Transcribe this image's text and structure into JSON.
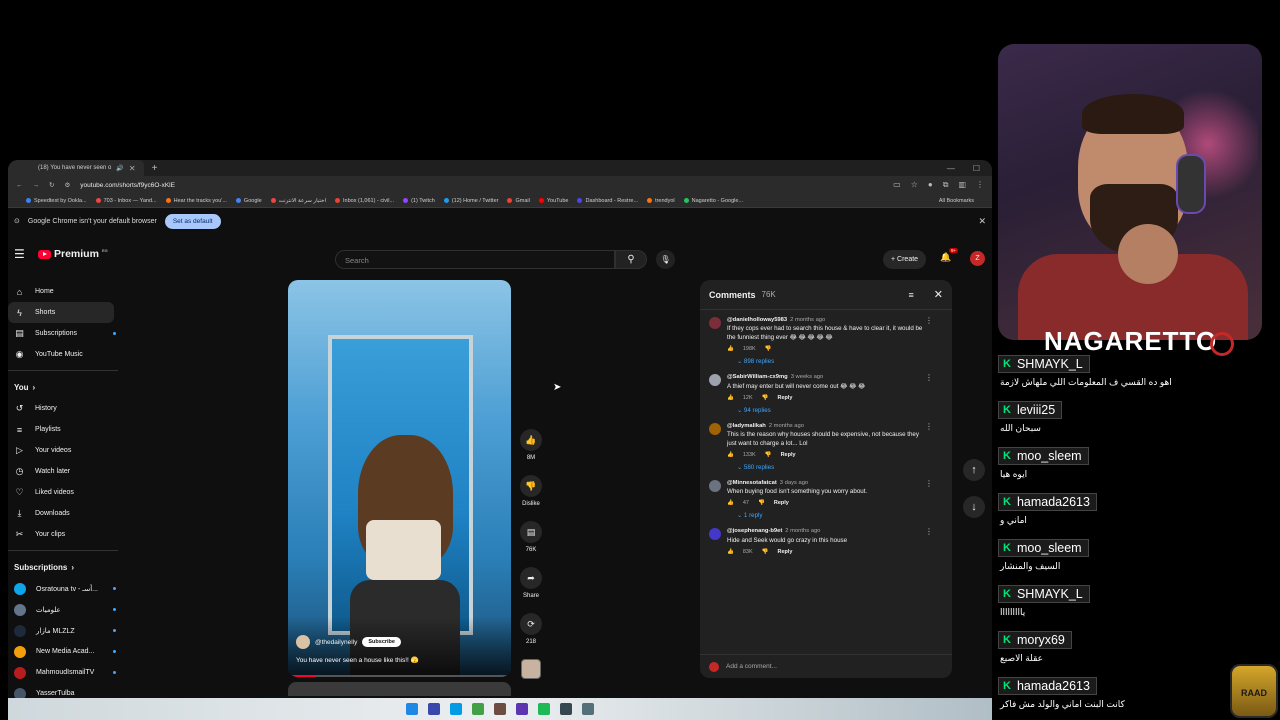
{
  "browser": {
    "tab_title": "(18) You have never seen o",
    "url": "youtube.com/shorts/f9yc6O-xKlE",
    "bookmarks": [
      {
        "label": "Speedtest by Ookla...",
        "color": "#3b82f6"
      },
      {
        "label": "703 - Inbox — Yand...",
        "color": "#ef4444"
      },
      {
        "label": "Hear the tracks you'...",
        "color": "#f97316"
      },
      {
        "label": "Google",
        "color": "#4285f4"
      },
      {
        "label": "اختبار سرعة الانترنت",
        "color": "#ef4444"
      },
      {
        "label": "Inbox (1,061) - civil...",
        "color": "#ea4335"
      },
      {
        "label": "(1) Twitch",
        "color": "#9146ff"
      },
      {
        "label": "(12) Home / Twitter",
        "color": "#1d9bf0"
      },
      {
        "label": "Gmail",
        "color": "#ea4335"
      },
      {
        "label": "YouTube",
        "color": "#ff0000"
      },
      {
        "label": "Dashboard - Restre...",
        "color": "#4f46e5"
      },
      {
        "label": "trendyol",
        "color": "#f97316"
      },
      {
        "label": "Nagaretto - Google...",
        "color": "#22c55e"
      }
    ],
    "all_bookmarks": "All Bookmarks",
    "infobar_text": "Google Chrome isn't your default browser",
    "set_default": "Set as default"
  },
  "youtube": {
    "logo_text": "Premium",
    "logo_sup": "EG",
    "search_placeholder": "Search",
    "create_label": "Create",
    "notif_badge": "9+",
    "avatar_letter": "Z",
    "nav": [
      {
        "label": "Home",
        "icon": "⌂"
      },
      {
        "label": "Shorts",
        "icon": "ϟ"
      },
      {
        "label": "Subscriptions",
        "icon": "▤"
      },
      {
        "label": "YouTube Music",
        "icon": "◉"
      }
    ],
    "you_title": "You",
    "you_items": [
      {
        "label": "History",
        "icon": "↺"
      },
      {
        "label": "Playlists",
        "icon": "≡"
      },
      {
        "label": "Your videos",
        "icon": "▷"
      },
      {
        "label": "Watch later",
        "icon": "◷"
      },
      {
        "label": "Liked videos",
        "icon": "♡"
      },
      {
        "label": "Downloads",
        "icon": "⤓"
      },
      {
        "label": "Your clips",
        "icon": "✂"
      }
    ],
    "subs_title": "Subscriptions",
    "subs": [
      {
        "label": "Osratouna tv - أسـ...",
        "color": "#0ea5e9"
      },
      {
        "label": "علوميات",
        "color": "#64748b"
      },
      {
        "label": "مازار MLZLZ",
        "color": "#1e293b"
      },
      {
        "label": "New Media Acad...",
        "color": "#f59e0b"
      },
      {
        "label": "MahmoudIsmailTV",
        "color": "#b91c1c"
      },
      {
        "label": "YasserTulba",
        "color": "#475569"
      }
    ],
    "short": {
      "channel": "@thedailynelly",
      "subscribe": "Subscribe",
      "caption": "You have never seen a house like this!! 🫣",
      "progress": 0.12
    },
    "actions": {
      "likes": "8M",
      "dislike": "Dislike",
      "comments": "76K",
      "share": "Share",
      "remix": "218"
    },
    "comments_panel": {
      "title": "Comments",
      "count": "76K",
      "add_placeholder": "Add a comment...",
      "items": [
        {
          "author": "@danielholloway5983",
          "time": "2 months ago",
          "text": "If they cops ever had to search this house & have to clear it, it would be the funniest thing ever 😂 😂 😂 😂 😂",
          "likes": "198K",
          "reply": "",
          "replies": "898 replies",
          "color": "#7c2d3a"
        },
        {
          "author": "@SabirWilliam-cx9mg",
          "time": "3 weeks ago",
          "text": "A thief may enter but will never come out 😂 😂 😂",
          "likes": "12K",
          "reply": "Reply",
          "replies": "94 replies",
          "color": "#9ca3af"
        },
        {
          "author": "@ladymalikah",
          "time": "2 months ago",
          "text": "This is the reason why houses should be expensive, not because they just want to charge a lot... Lol",
          "likes": "133K",
          "reply": "Reply",
          "replies": "580 replies",
          "color": "#a16207"
        },
        {
          "author": "@Minnesotafatcat",
          "time": "3 days ago",
          "text": "When buying food isn't something you worry about.",
          "likes": "47",
          "reply": "Reply",
          "replies": "1 reply",
          "color": "#6b7280"
        },
        {
          "author": "@josephenang-b9et",
          "time": "2 months ago",
          "text": "Hide and Seek would go crazy in this house",
          "likes": "83K",
          "reply": "Reply",
          "replies": "",
          "color": "#4338ca"
        }
      ]
    }
  },
  "stream": {
    "streamer_name": "NAGARETTO",
    "chat": [
      {
        "user": "SHMAYK_L",
        "text": "اهو ده القسي ف المعلومات اللي ملهاش لازمة"
      },
      {
        "user": "leviii25",
        "text": "سبحان الله"
      },
      {
        "user": "moo_sleem",
        "text": "ايوه هيا"
      },
      {
        "user": "hamada2613",
        "text": "اماني و"
      },
      {
        "user": "moo_sleem",
        "text": "السيف والمنشار"
      },
      {
        "user": "SHMAYK_L",
        "text": "يااااااااا"
      },
      {
        "user": "moryx69",
        "text": "عقلة الاصبع"
      },
      {
        "user": "hamada2613",
        "text": "كانت البنت اماني والولد مش فاكر"
      }
    ],
    "badge_letter": "K",
    "logo_text": "RAAD"
  }
}
